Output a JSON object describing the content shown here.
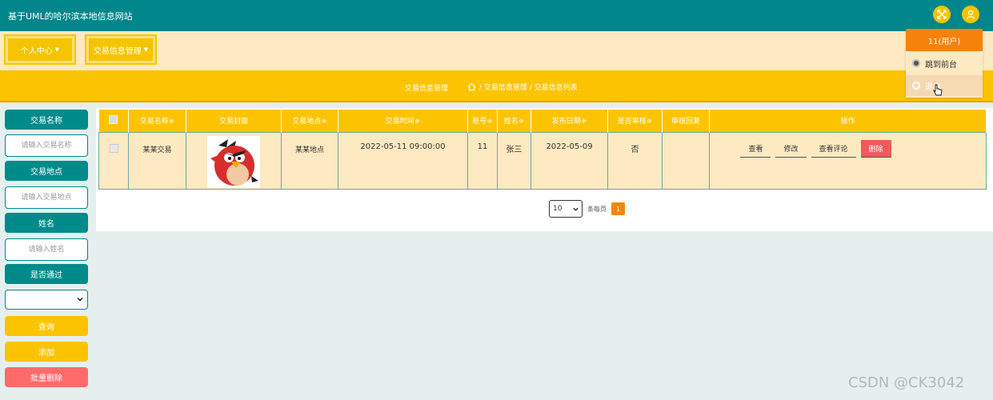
{
  "header": {
    "site_title": "基于UML的哈尔滨本地信息网站"
  },
  "nav": {
    "personal_center": "个人中心",
    "trade_info_mgmt": "交易信息管理"
  },
  "breadcrumb": {
    "page": "交易信息管理",
    "path": "/ 交易信息管理 / 交易信息列表"
  },
  "search": {
    "trade_name_label": "交易名称",
    "trade_name_placeholder": "请输入交易名称",
    "trade_place_label": "交易地点",
    "trade_place_placeholder": "请输入交易地点",
    "name_label": "姓名",
    "name_placeholder": "请输入姓名",
    "passed_label": "是否通过",
    "passed_value": "",
    "query_button": "查询",
    "add_button": "添加",
    "batch_delete_button": "批量删除"
  },
  "table": {
    "headers": [
      "交易名称≑",
      "交易封面",
      "交易地点≑",
      "交易时间≑",
      "账号≑",
      "姓名≑",
      "发布日期≑",
      "是否审核≑",
      "审核回复",
      "操作"
    ],
    "rows": [
      {
        "trade_name": "某某交易",
        "trade_place": "某某地点",
        "trade_time": "2022-05-11 09:00:00",
        "account": "11",
        "name": "张三",
        "publish_date": "2022-05-09",
        "reviewed": "否",
        "review_reply": ""
      }
    ],
    "actions": {
      "view": "查看",
      "edit": "修改",
      "view_comments": "查看评论",
      "delete": "删除"
    }
  },
  "pagination": {
    "page_size": "10",
    "per_page_label": "条每页",
    "current_page": "1"
  },
  "user_menu": {
    "title": "11(用户)",
    "to_frontend": "跳到前台",
    "logout": "退出"
  },
  "watermark": "CSDN @CK3042",
  "colors": {
    "teal": "#00868b",
    "yellow": "#fcc400",
    "cream": "#fde9c2",
    "orange": "#f5820b",
    "red": "#f05a5a",
    "pink": "#ff6b6b"
  }
}
